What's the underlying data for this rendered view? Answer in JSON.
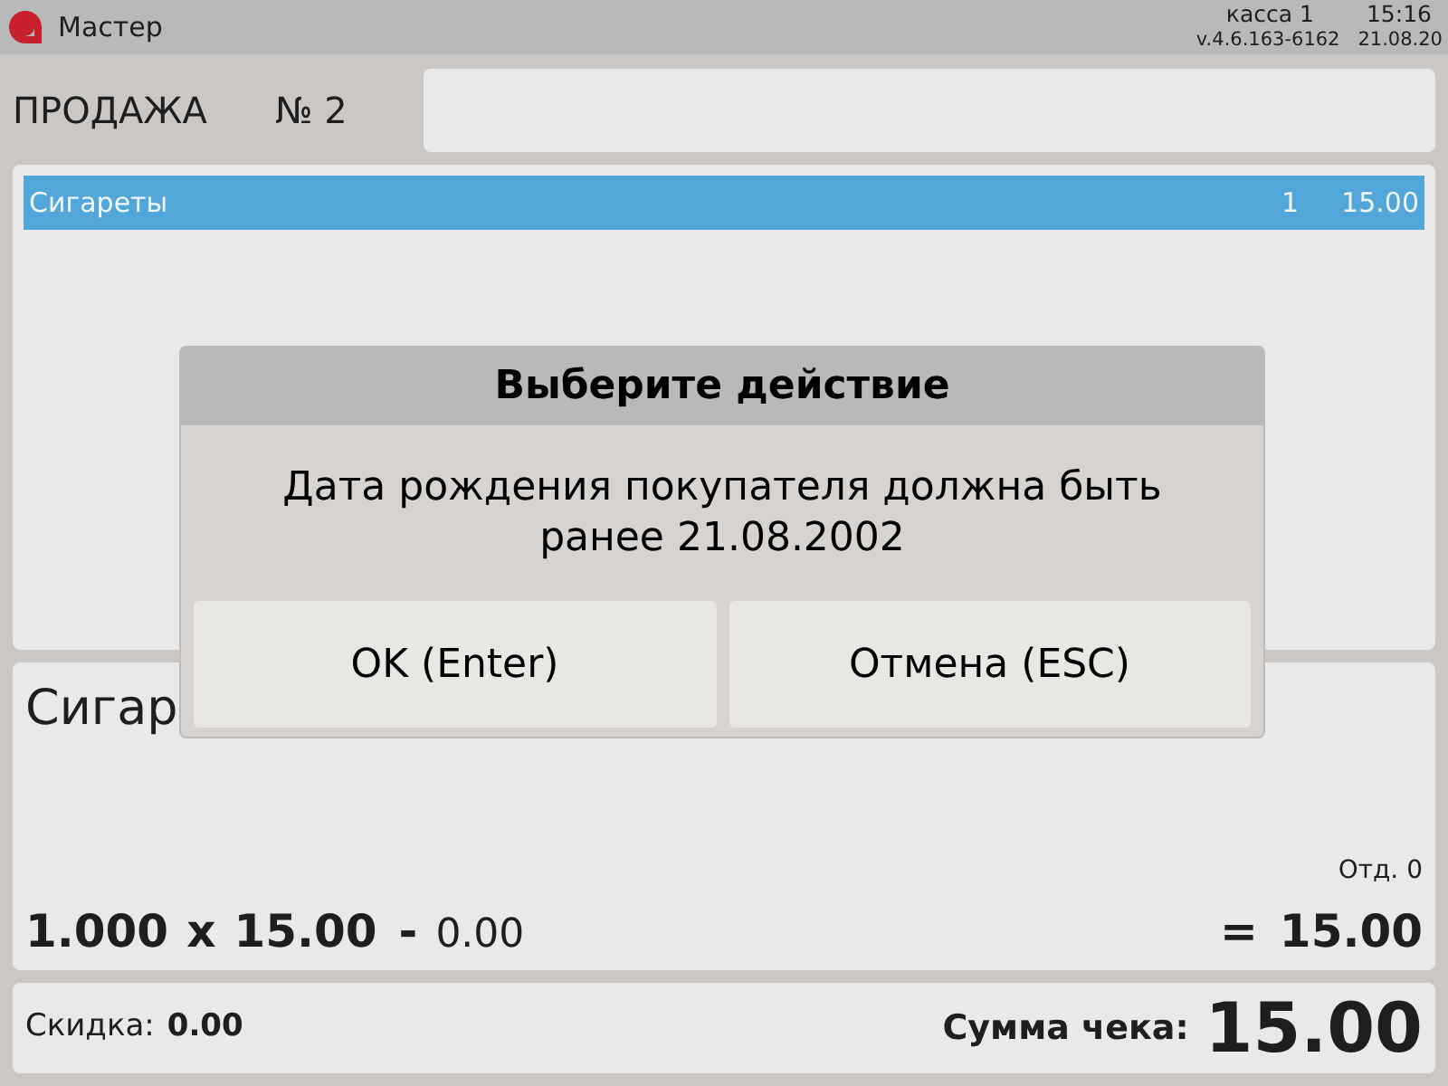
{
  "header": {
    "user": "Мастер",
    "register": "касса 1",
    "time": "15:16",
    "version": "v.4.6.163-6162",
    "date": "21.08.20"
  },
  "sale": {
    "title": "ПРОДАЖА",
    "number": "№ 2"
  },
  "receipt": {
    "rows": [
      {
        "name": "Сигареты",
        "quantity": "1",
        "sum": "15.00",
        "selected": true
      }
    ]
  },
  "item": {
    "name": "Сигар",
    "department": "Отд. 0",
    "quantity": "1.000",
    "times": "x",
    "price": "15.00",
    "minus": "-",
    "discount": "0.00",
    "equals": "=",
    "total": "15.00"
  },
  "footer": {
    "discount_label": "Скидка:",
    "discount": "0.00",
    "total_label": "Сумма чека:",
    "total": "15.00"
  },
  "dialog": {
    "title": "Выберите действие",
    "message": "Дата рождения покупателя должна быть ранее 21.08.2002",
    "buttons": [
      "OK (Enter)",
      "Отмена (ESC)"
    ]
  }
}
